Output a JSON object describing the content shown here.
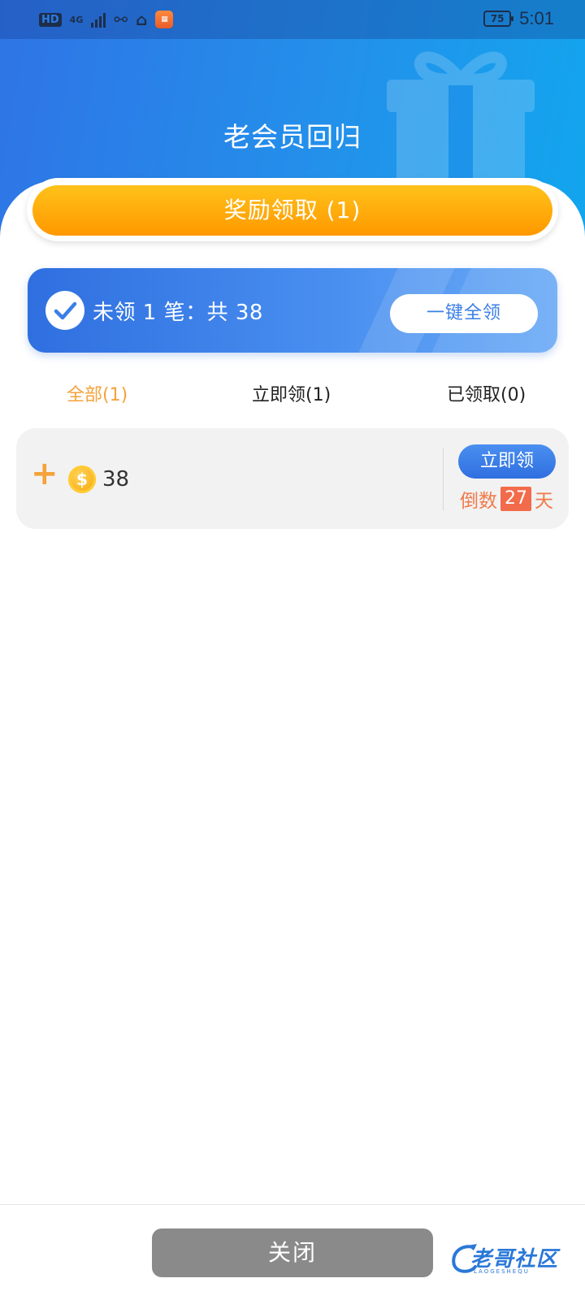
{
  "status_bar": {
    "hd": "HD",
    "network": "4G",
    "battery": "75",
    "time": "5:01"
  },
  "header": {
    "title": "老会员回归",
    "reward_button": "奖励领取 (1)"
  },
  "summary": {
    "text": "未领 1 笔：共 38",
    "claim_all_label": "一键全领"
  },
  "tabs": [
    {
      "label": "全部(1)",
      "active": true
    },
    {
      "label": "立即领(1)",
      "active": false
    },
    {
      "label": "已领取(0)",
      "active": false
    }
  ],
  "items": [
    {
      "prefix": "+",
      "amount": "38",
      "claim_label": "立即领",
      "countdown_prefix": "倒数",
      "countdown_value": "27",
      "countdown_suffix": "天"
    }
  ],
  "footer": {
    "close_label": "关闭",
    "watermark": "老哥社区",
    "watermark_sub": "LAOGESHEQU"
  },
  "colors": {
    "primary_blue": "#2f6fe0",
    "accent_orange": "#ff9800",
    "tab_active": "#f5a23a",
    "countdown": "#f26b4b"
  }
}
